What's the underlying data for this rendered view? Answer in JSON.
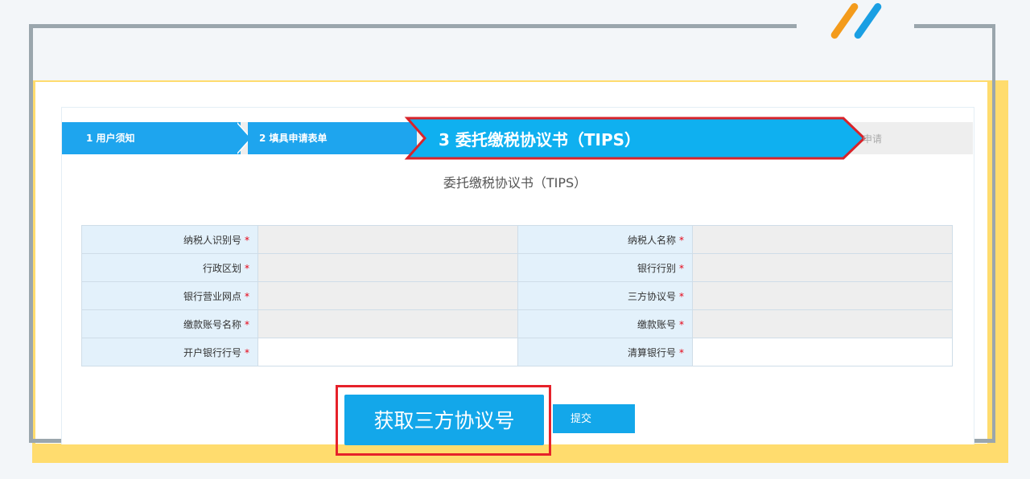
{
  "steps": {
    "step1": "1  用户须知",
    "step2": "2  填具申请表单",
    "step3": "3  委托缴税协议书（TIPS）",
    "step4": "申请"
  },
  "form": {
    "title": "委托缴税协议书（TIPS）",
    "required_mark": "*",
    "rows": [
      {
        "left_label": "纳税人识别号",
        "right_label": "纳税人名称"
      },
      {
        "left_label": "行政区划",
        "right_label": "银行行别"
      },
      {
        "left_label": "银行营业网点",
        "right_label": "三方协议号"
      },
      {
        "left_label": "缴款账号名称",
        "right_label": "缴款账号"
      },
      {
        "left_label": "开户银行行号",
        "right_label": "清算银行号"
      }
    ]
  },
  "actions": {
    "get_agreement": "获取三方协议号",
    "submit": "提交"
  },
  "colors": {
    "primary_blue": "#13a7ea",
    "highlight_red": "#e6212a",
    "required_red": "#e60012",
    "frame_yellow": "#ffdc6e",
    "frame_gray": "#9aa6ad"
  }
}
